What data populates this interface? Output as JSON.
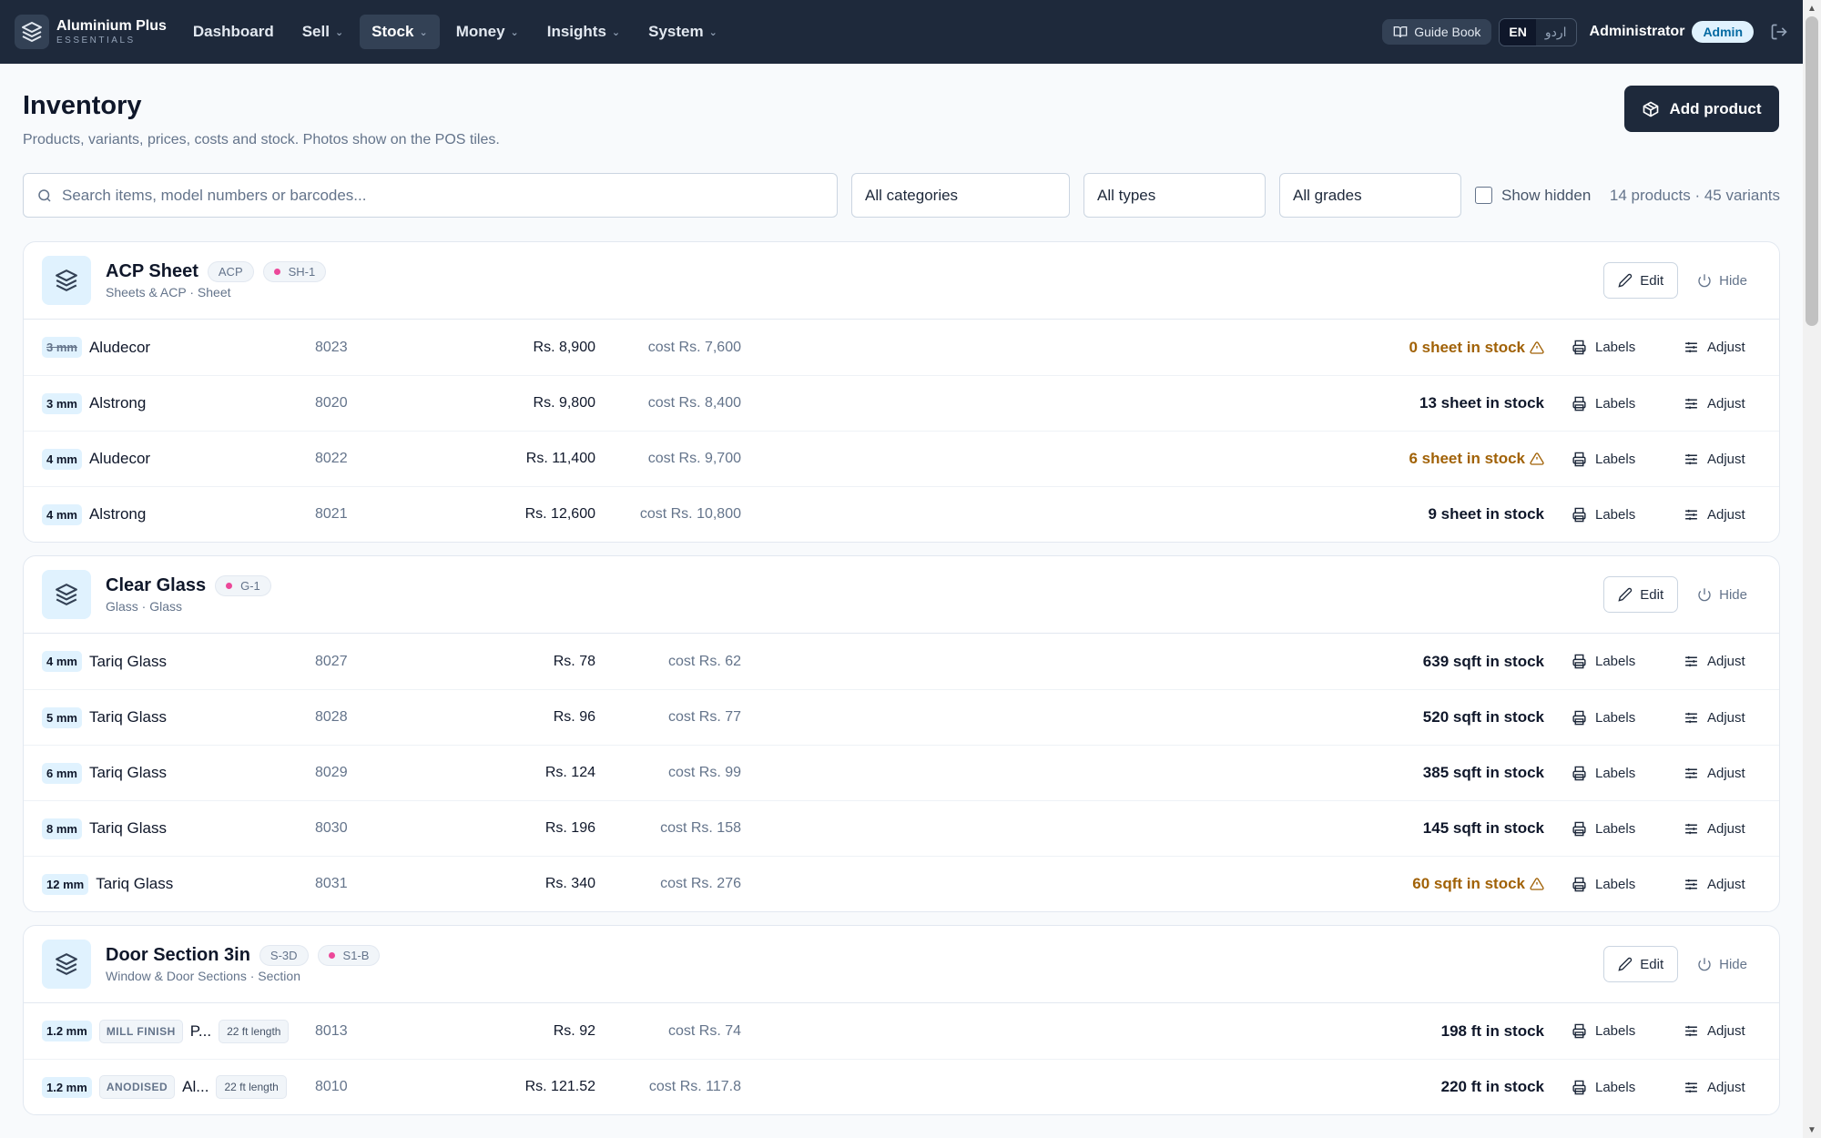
{
  "app": {
    "name": "Aluminium Plus",
    "edition": "ESSENTIALS"
  },
  "nav": {
    "items": [
      {
        "label": "Dashboard",
        "dropdown": false,
        "active": false
      },
      {
        "label": "Sell",
        "dropdown": true,
        "active": false
      },
      {
        "label": "Stock",
        "dropdown": true,
        "active": true
      },
      {
        "label": "Money",
        "dropdown": true,
        "active": false
      },
      {
        "label": "Insights",
        "dropdown": true,
        "active": false
      },
      {
        "label": "System",
        "dropdown": true,
        "active": false
      }
    ],
    "guide_label": "Guide Book",
    "lang_en": "EN",
    "lang_ur": "اردو",
    "user": "Administrator",
    "role": "Admin"
  },
  "page": {
    "title": "Inventory",
    "subtitle": "Products, variants, prices, costs and stock. Photos show on the POS tiles.",
    "add_label": "Add product"
  },
  "filters": {
    "search_placeholder": "Search items, model numbers or barcodes...",
    "category": "All categories",
    "type": "All types",
    "grade": "All grades",
    "show_hidden": "Show hidden",
    "summary": "14 products · 45 variants"
  },
  "actions": {
    "edit": "Edit",
    "hide": "Hide",
    "labels": "Labels",
    "adjust": "Adjust"
  },
  "colors": {
    "nav_bg": "#1e293b",
    "low_stock": "#a16207",
    "thickness_badge": "#e0f2fe",
    "grade_dot": "#ec4899"
  },
  "products": [
    {
      "name": "ACP Sheet",
      "tag": "ACP",
      "grade": "SH-1",
      "sub": "Sheets & ACP · Sheet",
      "variants": [
        {
          "thickness": "3 mm",
          "thickness_struck": true,
          "name": "Aludecor",
          "code": "8023",
          "price": "Rs. 8,900",
          "cost": "cost Rs. 7,600",
          "stock": "0 sheet in stock",
          "low": true
        },
        {
          "thickness": "3 mm",
          "name": "Alstrong",
          "code": "8020",
          "price": "Rs. 9,800",
          "cost": "cost Rs. 8,400",
          "stock": "13 sheet in stock",
          "low": false
        },
        {
          "thickness": "4 mm",
          "name": "Aludecor",
          "code": "8022",
          "price": "Rs. 11,400",
          "cost": "cost Rs. 9,700",
          "stock": "6 sheet in stock",
          "low": true
        },
        {
          "thickness": "4 mm",
          "name": "Alstrong",
          "code": "8021",
          "price": "Rs. 12,600",
          "cost": "cost Rs. 10,800",
          "stock": "9 sheet in stock",
          "low": false
        }
      ]
    },
    {
      "name": "Clear Glass",
      "grade": "G-1",
      "sub": "Glass · Glass",
      "variants": [
        {
          "thickness": "4 mm",
          "name": "Tariq Glass",
          "code": "8027",
          "price": "Rs. 78",
          "cost": "cost Rs. 62",
          "stock": "639 sqft in stock",
          "low": false
        },
        {
          "thickness": "5 mm",
          "name": "Tariq Glass",
          "code": "8028",
          "price": "Rs. 96",
          "cost": "cost Rs. 77",
          "stock": "520 sqft in stock",
          "low": false
        },
        {
          "thickness": "6 mm",
          "name": "Tariq Glass",
          "code": "8029",
          "price": "Rs. 124",
          "cost": "cost Rs. 99",
          "stock": "385 sqft in stock",
          "low": false
        },
        {
          "thickness": "8 mm",
          "name": "Tariq Glass",
          "code": "8030",
          "price": "Rs. 196",
          "cost": "cost Rs. 158",
          "stock": "145 sqft in stock",
          "low": false
        },
        {
          "thickness": "12 mm",
          "name": "Tariq Glass",
          "code": "8031",
          "price": "Rs. 340",
          "cost": "cost Rs. 276",
          "stock": "60 sqft in stock",
          "low": true
        }
      ]
    },
    {
      "name": "Door Section 3in",
      "tag": "S-3D",
      "grade": "S1-B",
      "sub": "Window & Door Sections · Section",
      "variants": [
        {
          "thickness": "1.2 mm",
          "finish": "MILL FINISH",
          "name": "P...",
          "length": "22 ft length",
          "code": "8013",
          "price": "Rs. 92",
          "cost": "cost Rs. 74",
          "stock": "198 ft in stock",
          "low": false
        },
        {
          "thickness": "1.2 mm",
          "finish": "ANODISED",
          "name": "Al...",
          "length": "22 ft length",
          "code": "8010",
          "price": "Rs. 121.52",
          "cost": "cost Rs. 117.8",
          "stock": "220 ft in stock",
          "low": false
        }
      ]
    }
  ]
}
